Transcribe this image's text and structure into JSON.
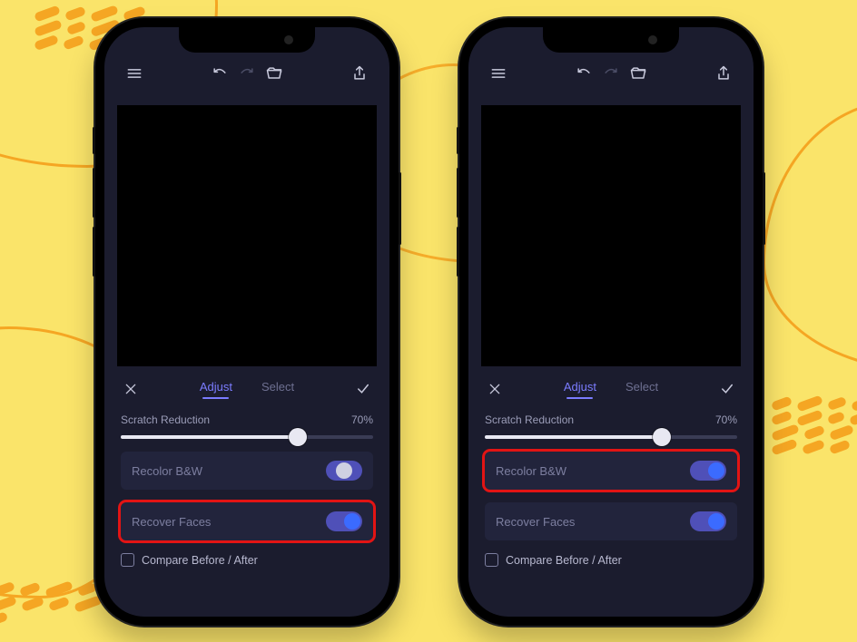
{
  "tabs": {
    "adjust": "Adjust",
    "select": "Select"
  },
  "slider": {
    "label": "Scratch Reduction",
    "value_text": "70%",
    "percent": 70
  },
  "toggles": {
    "recolor": "Recolor B&W",
    "recover": "Recover Faces"
  },
  "compare": {
    "label": "Compare Before / After"
  },
  "phones": [
    {
      "photo_mode": "bw",
      "recolor_state": "partial",
      "recover_state": "on",
      "highlight": "recover"
    },
    {
      "photo_mode": "color",
      "recolor_state": "on",
      "recover_state": "on",
      "highlight": "recolor"
    }
  ],
  "icons": {
    "menu": "menu-icon",
    "undo": "undo-icon",
    "redo": "redo-icon",
    "folder": "folder-open-icon",
    "share": "share-icon",
    "close": "close-icon",
    "check": "check-icon"
  }
}
